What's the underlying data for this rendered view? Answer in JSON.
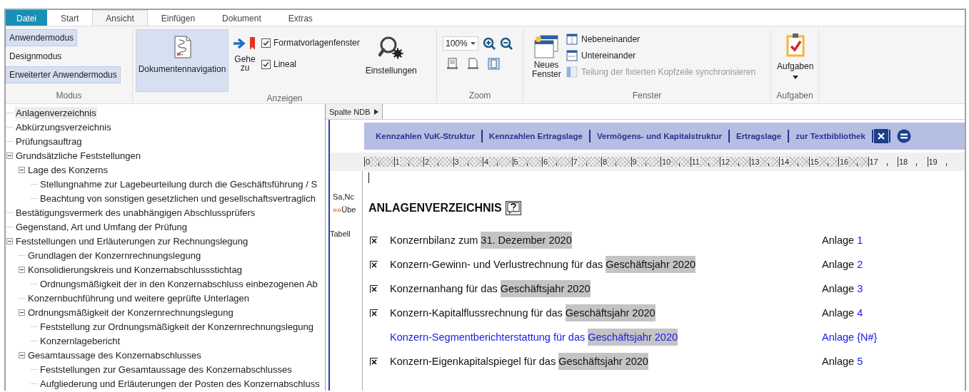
{
  "tabs": [
    {
      "label": "Datei",
      "kind": "file",
      "selected": false
    },
    {
      "label": "Start",
      "kind": "tab",
      "selected": false
    },
    {
      "label": "Ansicht",
      "kind": "tab",
      "selected": true
    },
    {
      "label": "Einfügen",
      "kind": "tab",
      "selected": false
    },
    {
      "label": "Dokument",
      "kind": "tab",
      "selected": false
    },
    {
      "label": "Extras",
      "kind": "tab",
      "selected": false
    }
  ],
  "ribbon": {
    "modus": {
      "label": "Modus",
      "buttons": [
        {
          "label": "Anwendermodus",
          "selected": true
        },
        {
          "label": "Designmodus",
          "selected": false
        },
        {
          "label": "Erweiterter Anwendermodus",
          "selected": true
        }
      ]
    },
    "anzeigen": {
      "label": "Anzeigen",
      "navigation": {
        "label": "Dokumentennavigation",
        "selected": true
      },
      "goto": "Gehe zu",
      "checkboxes": [
        {
          "label": "Formatvorlagenfenster",
          "checked": true
        },
        {
          "label": "Lineal",
          "checked": true
        }
      ],
      "settings": "Einstellungen"
    },
    "zoom": {
      "label": "Zoom",
      "value": "100%"
    },
    "fenster": {
      "label": "Fenster",
      "new_window": "Neues Fenster",
      "options": [
        {
          "label": "Nebeneinander",
          "kind": "side",
          "disabled": false
        },
        {
          "label": "Untereinander",
          "kind": "stack",
          "disabled": false
        },
        {
          "label": "Teilung der fixierten Kopfzeile synchronisieren",
          "kind": "split",
          "disabled": true
        }
      ]
    },
    "aufgaben": {
      "label": "Aufgaben",
      "button": "Aufgaben"
    }
  },
  "tree": [
    {
      "label": "Anlagenverzeichnis",
      "selected": true
    },
    {
      "label": "Abkürzungsverzeichnis",
      "selected": false
    },
    {
      "label": "Prüfungsauftrag",
      "selected": false
    },
    {
      "label": "Grundsätzliche Feststellungen",
      "selected": false,
      "expanded": true,
      "children": [
        {
          "label": "Lage des Konzerns",
          "selected": false,
          "expanded": true,
          "children": [
            {
              "label": "Stellungnahme zur Lagebeurteilung durch die Geschäftsführung / S",
              "selected": false
            },
            {
              "label": "Beachtung von sonstigen gesetzlichen und gesellschaftsvertraglich",
              "selected": false
            }
          ]
        }
      ]
    },
    {
      "label": "Bestätigungsvermerk des unabhängigen Abschlussprüfers",
      "selected": false
    },
    {
      "label": "Gegenstand, Art und Umfang der Prüfung",
      "selected": false
    },
    {
      "label": "Feststellungen und Erläuterungen zur Rechnungslegung",
      "selected": false,
      "expanded": true,
      "children": [
        {
          "label": "Grundlagen der Konzernrechnungslegung",
          "selected": false
        },
        {
          "label": "Konsolidierungskreis und Konzernabschlussstichtag",
          "selected": false,
          "expanded": true,
          "children": [
            {
              "label": "Ordnungsmäßigkeit der in den Konzernabschluss einbezogenen Ab",
              "selected": false
            }
          ]
        },
        {
          "label": "Konzernbuchführung und weitere geprüfte Unterlagen",
          "selected": false
        },
        {
          "label": "Ordnungsmäßigkeit der Konzernrechnungslegung",
          "selected": false,
          "expanded": true,
          "children": [
            {
              "label": "Feststellung zur Ordnungsmäßigkeit der Konzernrechnungslegung",
              "selected": false
            },
            {
              "label": "Konzernlagebericht",
              "selected": false
            }
          ]
        },
        {
          "label": "Gesamtaussage des Konzernabschlusses",
          "selected": false,
          "expanded": true,
          "children": [
            {
              "label": "Feststellungen zur Gesamtaussage des Konzernabschlusses",
              "selected": false
            },
            {
              "label": "Aufgliederung und Erläuterungen der Posten des Konzernabschluss",
              "selected": false
            }
          ]
        }
      ]
    }
  ],
  "document": {
    "column_button": "Spalte NDB",
    "nav_links": [
      "Kennzahlen VuK-Struktur",
      "Kennzahlen Ertragslage",
      "Vermögens- und Kapitalstruktur",
      "Ertragslage",
      "zur Textbibliothek"
    ],
    "ruler": [
      {
        "label": "0",
        "hatched": true
      },
      {
        "label": "1",
        "hatched": true
      },
      {
        "label": "2",
        "hatched": true
      },
      {
        "label": "3",
        "hatched": true
      },
      {
        "label": "4",
        "hatched": true
      },
      {
        "label": "5",
        "hatched": true
      },
      {
        "label": "6",
        "hatched": true
      },
      {
        "label": "7",
        "hatched": true
      },
      {
        "label": "8",
        "hatched": true
      },
      {
        "label": "9",
        "hatched": true
      },
      {
        "label": "10",
        "hatched": true
      },
      {
        "label": "11",
        "hatched": true
      },
      {
        "label": "12",
        "hatched": true
      },
      {
        "label": "13",
        "hatched": true
      },
      {
        "label": "14",
        "hatched": true
      },
      {
        "label": "15",
        "hatched": true
      },
      {
        "label": "16",
        "hatched": true
      },
      {
        "label": "17",
        "hatched": false
      },
      {
        "label": "18",
        "hatched": false
      },
      {
        "label": "19",
        "hatched": false
      }
    ],
    "margin_notes": [
      {
        "text": "Sa,Nc"
      },
      {
        "marker": "»»",
        "text": "Übe"
      },
      {
        "text": "Tabell"
      }
    ],
    "heading": "ANLAGENVERZEICHNIS",
    "entries": [
      {
        "kind": "active",
        "checked": true,
        "text": "Konzernbilanz zum ",
        "field": "31. Dezember 2020",
        "anlage": "Anlage",
        "number": "1"
      },
      {
        "kind": "active",
        "checked": true,
        "text": "Konzern-Gewinn- und Verlustrechnung für das ",
        "field": "Geschäftsjahr 2020",
        "anlage": "Anlage",
        "number": "2"
      },
      {
        "kind": "active",
        "checked": true,
        "text": "Konzernanhang für das ",
        "field": "Geschäftsjahr 2020",
        "anlage": "Anlage",
        "number": "3"
      },
      {
        "kind": "active",
        "checked": true,
        "text": "Konzern-Kapitalflussrechnung für das ",
        "field": "Geschäftsjahr 2020",
        "anlage": "Anlage",
        "number": "4"
      },
      {
        "kind": "pending",
        "checked": false,
        "text": "Konzern-Segmentberichterstattung für das ",
        "field": "Geschäftsjahr 2020",
        "anlage": "Anlage",
        "number": "{N#}"
      },
      {
        "kind": "active",
        "checked": true,
        "text": "Konzern-Eigenkapitalspiegel für das ",
        "field": "Geschäftsjahr 2020",
        "anlage": "Anlage",
        "number": "5"
      }
    ]
  }
}
